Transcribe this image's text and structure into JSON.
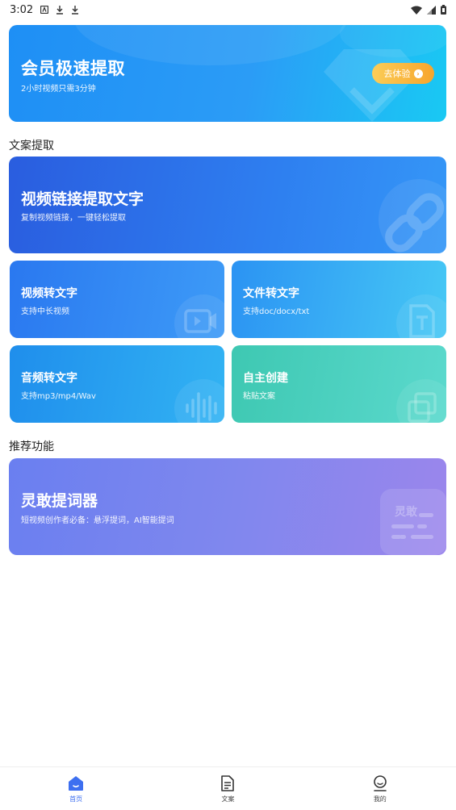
{
  "status_bar": {
    "time": "3:02",
    "icons": [
      "notification-a-icon",
      "download-icon",
      "download-icon",
      "wifi-icon",
      "signal-icon",
      "battery-icon"
    ]
  },
  "vip_card": {
    "title": "会员极速提取",
    "subtitle": "2小时视频只需3分钟",
    "button_label": "去体验",
    "icon": "diamond-icon"
  },
  "sections": {
    "extract_title": "文案提取",
    "recommend_title": "推荐功能"
  },
  "link_card": {
    "title": "视频链接提取文字",
    "subtitle": "复制视频链接，一键轻松提取",
    "icon": "link-icon"
  },
  "tools": [
    {
      "title": "视频转文字",
      "subtitle": "支持中长视频",
      "icon": "video-camera-icon"
    },
    {
      "title": "文件转文字",
      "subtitle": "支持doc/docx/txt",
      "icon": "text-file-icon"
    },
    {
      "title": "音频转文字",
      "subtitle": "支持mp3/mp4/Wav",
      "icon": "sound-wave-icon"
    },
    {
      "title": "自主创建",
      "subtitle": "粘贴文案",
      "icon": "copy-icon"
    }
  ],
  "prompter_card": {
    "title": "灵敢提词器",
    "subtitle": "短视频创作者必备：悬浮提词，AI智能提词",
    "badge_text": "灵敢",
    "icon": "teleprompter-icon"
  },
  "bottom_nav": [
    {
      "label": "首页",
      "icon": "home-icon",
      "active": true
    },
    {
      "label": "文案",
      "icon": "document-icon",
      "active": false
    },
    {
      "label": "我的",
      "icon": "profile-icon",
      "active": false
    }
  ],
  "colors": {
    "accent": "#3d6ff0",
    "vip_button": "#f7a52c"
  }
}
